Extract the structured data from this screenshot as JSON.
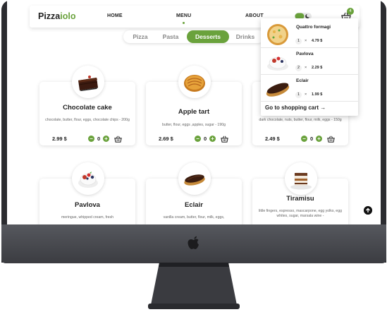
{
  "brand": {
    "part1": "Pizza",
    "part2": "iolo",
    "accent_color": "#6aa23c"
  },
  "nav": {
    "home": "HOME",
    "menu": "MENU",
    "about": "ABOUT"
  },
  "cart_badge": "4",
  "tabs": [
    "Pizza",
    "Pasta",
    "Desserts",
    "Drinks"
  ],
  "active_tab": "Desserts",
  "products": [
    {
      "title": "Chocolate cake",
      "description": "chocolate, butter, flour, eggs, chocolate chips - 200g",
      "price": "2.99 $",
      "qty": "0",
      "image_icon": "chocolate-cake-icon"
    },
    {
      "title": "Apple tart",
      "description": "butter, flour, eggs ,apples, sugar - 190g",
      "price": "2.69 $",
      "qty": "0",
      "image_icon": "apple-tart-icon"
    },
    {
      "title": "",
      "description": "dark chocolate, nuts, butter, flour, milk, eggs - 150g",
      "price": "2.49 $",
      "qty": "0",
      "image_icon": ""
    },
    {
      "title": "Pavlova",
      "description": "meringue, whipped cream, fresh",
      "image_icon": "pavlova-icon"
    },
    {
      "title": "Eclair",
      "description": "vanilla cream, butter, flour, milk, eggs,",
      "image_icon": "eclair-icon"
    },
    {
      "title": "Tiramisu",
      "description": "little fingers, espresso, mascarpone, egg yolks, egg whites, sugar, marsala wine -",
      "image_icon": "tiramisu-icon"
    }
  ],
  "cart": {
    "items": [
      {
        "name": "Quattro formagi",
        "qty": "1",
        "times": "×",
        "price": "4.79 $"
      },
      {
        "name": "Pavlova",
        "qty": "2",
        "times": "×",
        "price": "2.29 $"
      },
      {
        "name": "Eclair",
        "qty": "1",
        "times": "×",
        "price": "1.99 $"
      }
    ],
    "checkout": "Go to shopping cart →"
  }
}
